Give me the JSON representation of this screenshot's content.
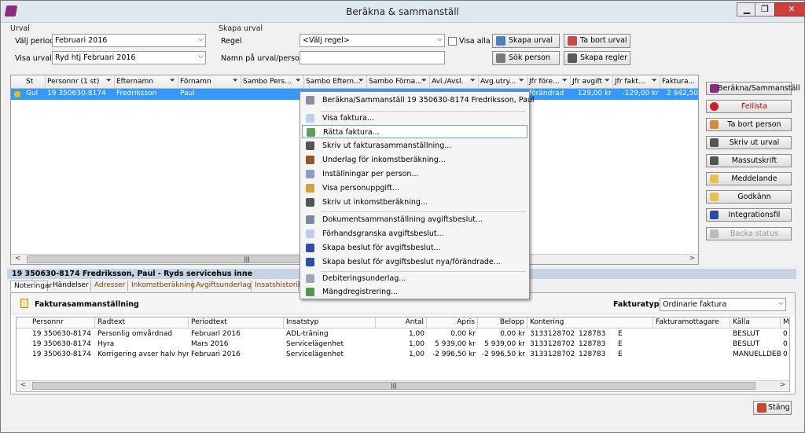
{
  "window": {
    "title": "Beräkna & sammanställ",
    "min": "▁",
    "max": "❐",
    "close": "✕"
  },
  "urval": {
    "group": "Urval",
    "period_label": "Välj period",
    "period_value": "Februari 2016",
    "visa_label": "Visa urval",
    "visa_value": "Ryd htj  Februari 2016"
  },
  "skapa": {
    "group": "Skapa urval",
    "regel_label": "Regel",
    "regel_value": "<Välj regel>",
    "visa_alla": "Visa alla",
    "namn_label": "Namn på urval/personnr",
    "namn_value": ""
  },
  "toolbar": {
    "skapa_urval": "Skapa urval",
    "ta_bort_urval": "Ta bort urval",
    "sok_person": "Sök person",
    "skapa_regler": "Skapa regler"
  },
  "grid": {
    "headers": [
      "St",
      "Personnr (1 st)",
      "Efternamn",
      "Förnamn",
      "Sambo Pers...",
      "Sambo Eftern...",
      "Sambo Förna...",
      "Avl./Avsl.",
      "Avg.utry...",
      "Jfr före...",
      "Jfr avgift",
      "Jfr fakt...",
      "Faktura..."
    ],
    "row": [
      "Gul",
      "19 350630-8174",
      "Fredriksson",
      "Paul",
      "",
      "",
      "",
      "",
      "",
      "förändrad",
      "129,00 kr",
      "-129,00 kr",
      "2 942,50"
    ]
  },
  "side_buttons": [
    "Beräkna/Sammanställ",
    "Fellista",
    "Ta bort person",
    "Skriv ut urval",
    "Massutskrift",
    "Meddelande",
    "Godkänn",
    "Integrationsfil",
    "Backa status"
  ],
  "info": "19 350630-8174 Fredriksson, Paul  -  Ryds servicehus inne",
  "tabs": [
    "Noteringar",
    "Händelser",
    "Adresser",
    "Inkomstberäkning",
    "Avgiftsunderlag",
    "Insatshistorik"
  ],
  "panel": {
    "title": "Fakturasammanställning",
    "fakturatyp_label": "Fakturatyp",
    "fakturatyp_value": "Ordinarie faktura"
  },
  "sub": {
    "headers": [
      "Personnr",
      "Radtext",
      "Periodtext",
      "Insatstyp",
      "Antal",
      "Apris",
      "Belopp",
      "Kontering",
      "",
      "",
      "Fakturamottagare",
      "Källa",
      "Mo"
    ],
    "rows": [
      [
        "19 350630-8174",
        "Personlig omvårdnad",
        "Februari 2016",
        "ADL-träning",
        "1,00",
        "0,00 kr",
        "0,00 kr",
        "3133128702",
        "128783",
        "E",
        "",
        "BESLUT",
        "0"
      ],
      [
        "19 350630-8174",
        "Hyra",
        "Mars 2016",
        "Servicelägenhet",
        "1,00",
        "5 939,00 kr",
        "5 939,00 kr",
        "3133128702",
        "128783",
        "E",
        "",
        "BESLUT",
        "0"
      ],
      [
        "19 350630-8174",
        "Korrigering avser halv hyr...",
        "Februari 2016",
        "Servicelägenhet",
        "1,00",
        "-2 996,50 kr",
        "-2 996,50 kr",
        "3133128702",
        "128783",
        "E",
        "",
        "MANUELLDEB",
        "0"
      ]
    ]
  },
  "stang": "Stäng",
  "menu": [
    "Beräkna/Sammanställ 19 350630-8174 Fredriksson, Paul",
    "Visa faktura...",
    "Rätta faktura...",
    "Skriv ut fakturasammanställning...",
    "Underlag för inkomstberäkning...",
    "Inställningar per person...",
    "Visa personuppgift...",
    "Skriv ut inkomstberäkning...",
    "Dokumentsammanställning avgiftsbeslut...",
    "Förhandsgranska avgiftsbeslut...",
    "Skapa beslut för avgiftsbeslut...",
    "Skapa beslut för avgiftsbeslut nya/förändrade...",
    "Debiteringsunderlag...",
    "Mängdregistrering..."
  ],
  "filter_icon": "filter-icon",
  "hscroll": {
    "left": "<",
    "right": ">",
    "thumb": "|||"
  }
}
